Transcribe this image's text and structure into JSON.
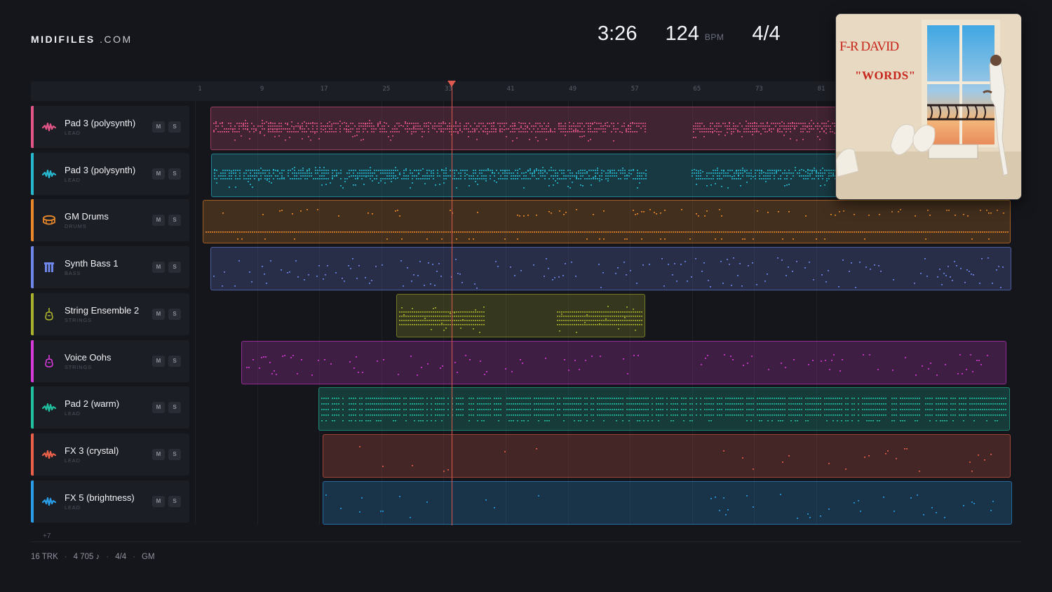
{
  "header": {
    "logo_bold": "MIDIFILES",
    "logo_dot": ".COM",
    "duration": "3:26",
    "bpm_value": "124",
    "bpm_unit": "BPM",
    "time_signature": "4/4"
  },
  "timeline": {
    "ticks": [
      "1",
      "9",
      "17",
      "25",
      "33",
      "41",
      "49",
      "57",
      "65",
      "73",
      "81"
    ]
  },
  "playhead": {
    "bar": 33.4
  },
  "tracks": [
    {
      "name": "Pad 3 (polysynth)",
      "type": "LEAD",
      "color": "#e05585",
      "icon": "wave-icon",
      "mute": "M",
      "solo": "S"
    },
    {
      "name": "Pad 3 (polysynth)",
      "type": "LEAD",
      "color": "#26b8cf",
      "icon": "wave-icon",
      "mute": "M",
      "solo": "S"
    },
    {
      "name": "GM Drums",
      "type": "DRUMS",
      "color": "#e8882a",
      "icon": "drum-icon",
      "mute": "M",
      "solo": "S"
    },
    {
      "name": "Synth Bass 1",
      "type": "BASS",
      "color": "#6d86e8",
      "icon": "bass-icon",
      "mute": "M",
      "solo": "S"
    },
    {
      "name": "String Ensemble 2",
      "type": "STRINGS",
      "color": "#a9b12c",
      "icon": "violin-icon",
      "mute": "M",
      "solo": "S"
    },
    {
      "name": "Voice Oohs",
      "type": "STRINGS",
      "color": "#d43ad6",
      "icon": "violin-icon",
      "mute": "M",
      "solo": "S"
    },
    {
      "name": "Pad 2 (warm)",
      "type": "LEAD",
      "color": "#1fbfa0",
      "icon": "wave-icon",
      "mute": "M",
      "solo": "S"
    },
    {
      "name": "FX 3 (crystal)",
      "type": "LEAD",
      "color": "#e8604a",
      "icon": "wave-icon",
      "mute": "M",
      "solo": "S"
    },
    {
      "name": "FX 5 (brightness)",
      "type": "LEAD",
      "color": "#2a9de8",
      "icon": "wave-icon",
      "mute": "M",
      "solo": "S"
    }
  ],
  "more_tracks": "+7",
  "footer": {
    "tracks": "16 TRK",
    "notes": "4 705 ♪",
    "meter": "4/4",
    "standard": "GM"
  },
  "album": {
    "artist": "F-R DAVID",
    "title": "\"WORDS\""
  }
}
